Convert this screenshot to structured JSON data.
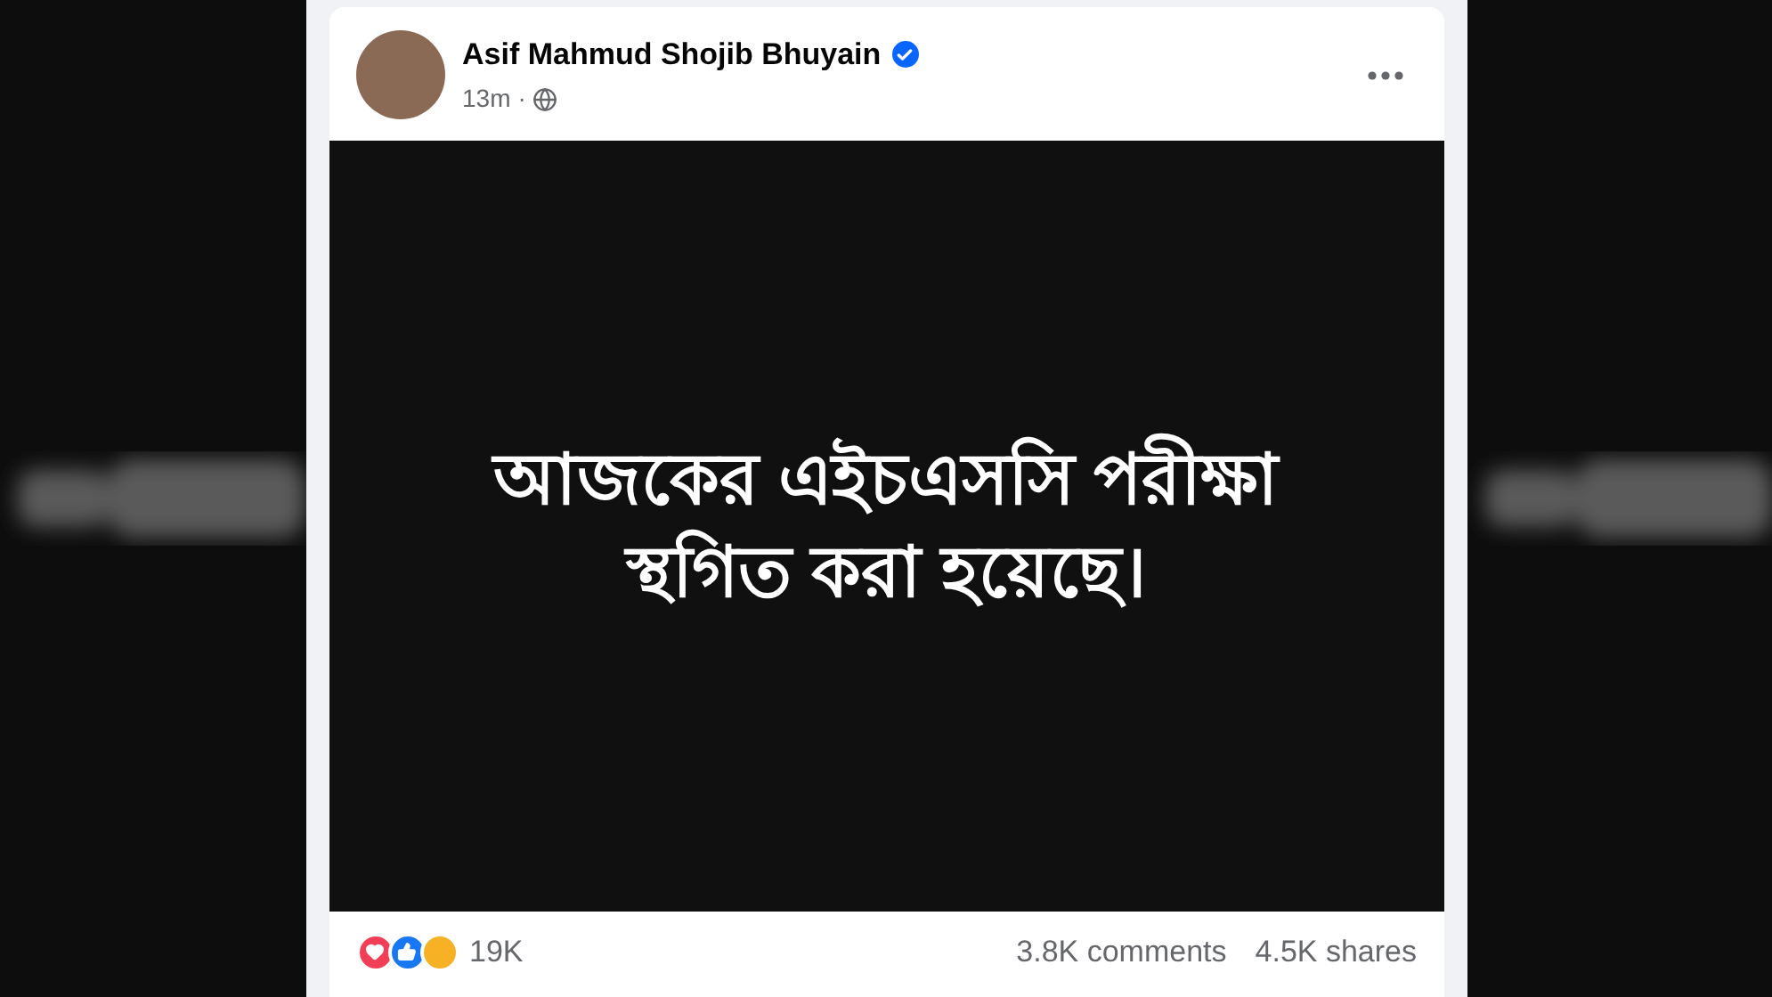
{
  "post": {
    "author": "Asif Mahmud Shojib Bhuyain",
    "verified": true,
    "time": "13m",
    "dot": "·",
    "image_text": [
      "আজকের এইচএসসি পরীক্ষা",
      "স্থগিত করা হয়েছে।"
    ],
    "reactions_count": "19K",
    "comments": "3.8K comments",
    "shares": "4.5K shares"
  }
}
